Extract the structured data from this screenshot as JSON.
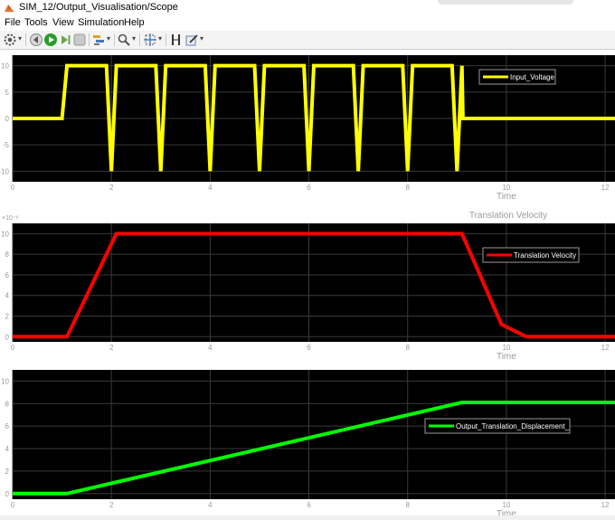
{
  "window": {
    "title": "SIM_12/Output_Visualisation/Scope"
  },
  "menu": [
    "File",
    "Tools",
    "View",
    "Simulation",
    "Help"
  ],
  "toolbar": {
    "icons": [
      "settings-icon",
      "step-back-icon",
      "run-icon",
      "step-forward-icon",
      "stop-icon",
      "highlight-icon",
      "zoom-icon",
      "autoscale-icon",
      "cursor-measure-icon",
      "edit-style-icon"
    ]
  },
  "colors": {
    "yellow": "#ffff00",
    "red": "#ff0000",
    "green": "#00ff00",
    "axes_bg": "#000000",
    "tick": "#9a9a9a"
  },
  "chart_data": [
    {
      "type": "line",
      "title": "",
      "xlabel": "Time",
      "ylabel": "",
      "xlim": [
        0,
        12.2
      ],
      "ylim": [
        -12,
        12
      ],
      "xticks": [
        0,
        2,
        4,
        6,
        8,
        10,
        12
      ],
      "yticks": [
        -10,
        -5,
        0,
        5,
        10
      ],
      "exponent": "",
      "grid": true,
      "legend_position": "top-right",
      "series": [
        {
          "name": "Input_Voltage",
          "color": "#ffff00",
          "x": [
            0,
            1.0,
            1.1,
            1.9,
            2.0,
            2.1,
            2.9,
            3.0,
            3.1,
            3.9,
            4.0,
            4.1,
            4.9,
            5.0,
            5.1,
            5.9,
            6.0,
            6.1,
            6.9,
            7.0,
            7.1,
            7.9,
            8.0,
            8.1,
            8.9,
            9.0,
            9.1,
            9.12,
            12.2
          ],
          "y": [
            0,
            0,
            10,
            10,
            -10,
            10,
            10,
            -10,
            10,
            10,
            -10,
            10,
            10,
            -10,
            10,
            10,
            -10,
            10,
            10,
            -10,
            10,
            10,
            -10,
            10,
            10,
            -10,
            10,
            0,
            0
          ]
        }
      ]
    },
    {
      "type": "line",
      "title": "Translation Velocity",
      "xlabel": "Time",
      "ylabel": "",
      "xlim": [
        0,
        12.2
      ],
      "ylim": [
        -0.5,
        11
      ],
      "xticks": [
        0,
        2,
        4,
        6,
        8,
        10,
        12
      ],
      "yticks": [
        0,
        2,
        4,
        6,
        8,
        10
      ],
      "exponent": "×10⁻⁸",
      "grid": true,
      "legend_position": "top-right",
      "series": [
        {
          "name": "Translation Velocity",
          "color": "#ff0000",
          "x": [
            0,
            1.1,
            1.6,
            2.1,
            9.1,
            9.9,
            10.4,
            12.2
          ],
          "y": [
            0,
            0,
            5,
            10,
            10,
            1.2,
            0,
            0
          ]
        }
      ]
    },
    {
      "type": "line",
      "title": "",
      "xlabel": "Time",
      "ylabel": "",
      "xlim": [
        0,
        12.2
      ],
      "ylim": [
        -0.5,
        11
      ],
      "xticks": [
        0,
        2,
        4,
        6,
        8,
        10,
        12
      ],
      "yticks": [
        0,
        2,
        4,
        6,
        8,
        10
      ],
      "exponent": "",
      "grid": true,
      "legend_position": "right",
      "series": [
        {
          "name": "Output_Translation_Displacement_",
          "color": "#00ff00",
          "x": [
            0,
            1.1,
            9.1,
            12.2
          ],
          "y": [
            0,
            0,
            8.1,
            8.1
          ]
        }
      ]
    }
  ]
}
